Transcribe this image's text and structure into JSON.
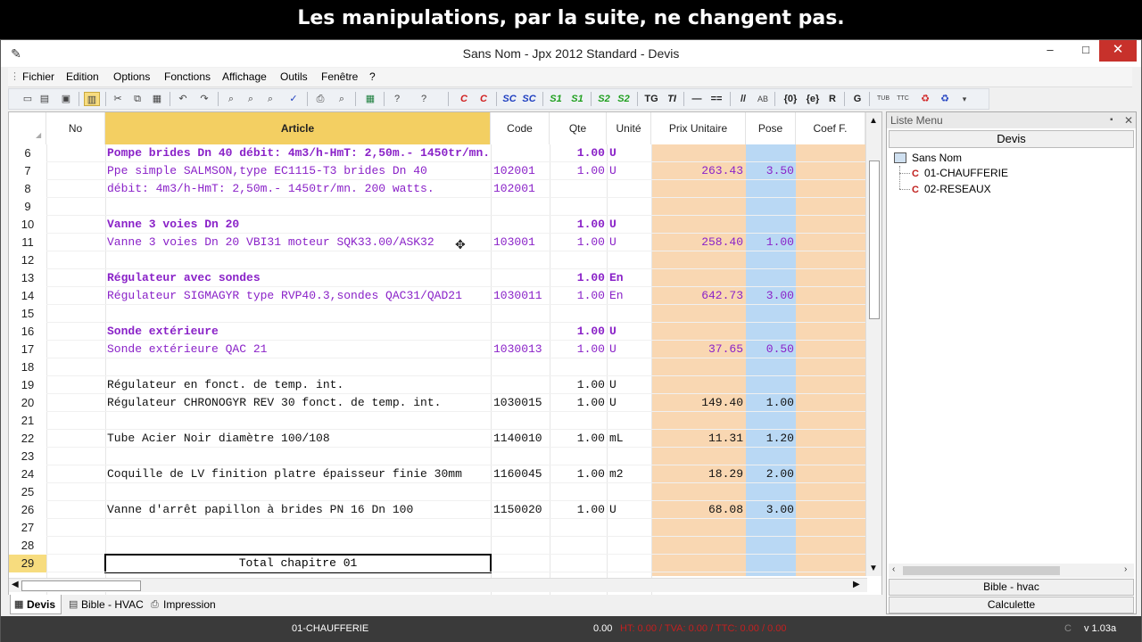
{
  "caption": "Les manipulations, par la suite, ne changent pas.",
  "window": {
    "title": "Sans Nom - Jpx 2012 Standard - Devis",
    "minimize": "–",
    "maximize": "□",
    "close": "✕"
  },
  "menu": [
    "Fichier",
    "Edition",
    "Options",
    "Fonctions",
    "Affichage",
    "Outils",
    "Fenêtre",
    "?"
  ],
  "toolbar": {
    "text_buttons": [
      {
        "label": "C",
        "style": "red",
        "name": "c-red-button"
      },
      {
        "label": "C",
        "style": "red",
        "name": "c-red-italic-button"
      },
      {
        "label": "SC",
        "style": "blue",
        "name": "sc-button"
      },
      {
        "label": "SC",
        "style": "blue",
        "name": "sc-italic-button"
      },
      {
        "label": "S1",
        "style": "green",
        "name": "s1-button"
      },
      {
        "label": "S1",
        "style": "green",
        "name": "s1-italic-button"
      },
      {
        "label": "S2",
        "style": "green",
        "name": "s2-button"
      },
      {
        "label": "S2",
        "style": "green",
        "name": "s2-italic-button"
      },
      {
        "label": "TG",
        "style": "dark",
        "name": "tg-button"
      },
      {
        "label": "TI",
        "style": "dark",
        "name": "ti-button"
      },
      {
        "label": "—",
        "style": "dark",
        "name": "dash-button"
      },
      {
        "label": "==",
        "style": "dark",
        "name": "double-line-button"
      },
      {
        "label": "//",
        "style": "dark",
        "name": "comment-button"
      },
      {
        "label": "AB",
        "style": "gray",
        "name": "ab-button"
      },
      {
        "label": "{0}",
        "style": "dark",
        "name": "brace-zero-button"
      },
      {
        "label": "{e}",
        "style": "dark",
        "name": "brace-e-button"
      },
      {
        "label": "R",
        "style": "dark",
        "name": "r-button"
      },
      {
        "label": "G",
        "style": "dark",
        "name": "g-button"
      },
      {
        "label": "TUB",
        "style": "gray",
        "name": "tub-button"
      },
      {
        "label": "TTC",
        "style": "gray",
        "name": "ttc-button"
      }
    ]
  },
  "grid": {
    "headers": {
      "no": "No",
      "article": "Article",
      "code": "Code",
      "qte": "Qte",
      "unite": "Unité",
      "prix": "Prix Unitaire",
      "pose": "Pose",
      "coef": "Coef F."
    },
    "rows": [
      {
        "n": "6",
        "article": "Pompe brides Dn 40 débit: 4m3/h-HmT: 2,50m.- 1450tr/mn.",
        "code": "",
        "qte": "1.00",
        "unite": "U",
        "prix": "",
        "pose": "",
        "style": "purple-bold"
      },
      {
        "n": "7",
        "article": "Ppe simple SALMSON,type EC1115-T3 brides Dn 40",
        "code": "102001",
        "qte": "1.00",
        "unite": "U",
        "prix": "263.43",
        "pose": "3.50",
        "style": "purple"
      },
      {
        "n": "8",
        "article": "débit: 4m3/h-HmT: 2,50m.- 1450tr/mn. 200 watts.",
        "code": "102001",
        "qte": "",
        "unite": "",
        "prix": "",
        "pose": "",
        "style": "purple"
      },
      {
        "n": "9",
        "article": "",
        "code": "",
        "qte": "",
        "unite": "",
        "prix": "",
        "pose": "",
        "style": "black"
      },
      {
        "n": "10",
        "article": "Vanne 3 voies Dn 20",
        "code": "",
        "qte": "1.00",
        "unite": "U",
        "prix": "",
        "pose": "",
        "style": "purple-bold"
      },
      {
        "n": "11",
        "article": "Vanne 3 voies Dn 20 VBI31 moteur SQK33.00/ASK32",
        "code": "103001",
        "qte": "1.00",
        "unite": "U",
        "prix": "258.40",
        "pose": "1.00",
        "style": "purple"
      },
      {
        "n": "12",
        "article": "",
        "code": "",
        "qte": "",
        "unite": "",
        "prix": "",
        "pose": "",
        "style": "black"
      },
      {
        "n": "13",
        "article": "Régulateur avec sondes",
        "code": "",
        "qte": "1.00",
        "unite": "En",
        "prix": "",
        "pose": "",
        "style": "purple-bold"
      },
      {
        "n": "14",
        "article": "Régulateur SIGMAGYR type RVP40.3,sondes QAC31/QAD21",
        "code": "1030011",
        "qte": "1.00",
        "unite": "En",
        "prix": "642.73",
        "pose": "3.00",
        "style": "purple"
      },
      {
        "n": "15",
        "article": "",
        "code": "",
        "qte": "",
        "unite": "",
        "prix": "",
        "pose": "",
        "style": "black"
      },
      {
        "n": "16",
        "article": "Sonde extérieure",
        "code": "",
        "qte": "1.00",
        "unite": "U",
        "prix": "",
        "pose": "",
        "style": "purple-bold"
      },
      {
        "n": "17",
        "article": "Sonde extérieure QAC 21",
        "code": "1030013",
        "qte": "1.00",
        "unite": "U",
        "prix": "37.65",
        "pose": "0.50",
        "style": "purple"
      },
      {
        "n": "18",
        "article": "",
        "code": "",
        "qte": "",
        "unite": "",
        "prix": "",
        "pose": "",
        "style": "black"
      },
      {
        "n": "19",
        "article": "Régulateur en fonct. de temp. int.",
        "code": "",
        "qte": "1.00",
        "unite": "U",
        "prix": "",
        "pose": "",
        "style": "black"
      },
      {
        "n": "20",
        "article": "Régulateur CHRONOGYR REV 30 fonct. de temp. int.",
        "code": "1030015",
        "qte": "1.00",
        "unite": "U",
        "prix": "149.40",
        "pose": "1.00",
        "style": "black"
      },
      {
        "n": "21",
        "article": "",
        "code": "",
        "qte": "",
        "unite": "",
        "prix": "",
        "pose": "",
        "style": "black"
      },
      {
        "n": "22",
        "article": "Tube Acier Noir diamètre 100/108",
        "code": "1140010",
        "qte": "1.00",
        "unite": "mL",
        "prix": "11.31",
        "pose": "1.20",
        "style": "black"
      },
      {
        "n": "23",
        "article": "",
        "code": "",
        "qte": "",
        "unite": "",
        "prix": "",
        "pose": "",
        "style": "black"
      },
      {
        "n": "24",
        "article": "Coquille de LV finition platre épaisseur finie 30mm",
        "code": "1160045",
        "qte": "1.00",
        "unite": "m2",
        "prix": "18.29",
        "pose": "2.00",
        "style": "black"
      },
      {
        "n": "25",
        "article": "",
        "code": "",
        "qte": "",
        "unite": "",
        "prix": "",
        "pose": "",
        "style": "black"
      },
      {
        "n": "26",
        "article": "Vanne d'arrêt papillon à brides PN 16 Dn 100",
        "code": "1150020",
        "qte": "1.00",
        "unite": "U",
        "prix": "68.08",
        "pose": "3.00",
        "style": "black"
      },
      {
        "n": "27",
        "article": "",
        "code": "",
        "qte": "",
        "unite": "",
        "prix": "",
        "pose": "",
        "style": "black"
      },
      {
        "n": "28",
        "article": "",
        "code": "",
        "qte": "",
        "unite": "",
        "prix": "",
        "pose": "",
        "style": "black"
      },
      {
        "n": "29",
        "article": "Total chapitre 01",
        "code": "",
        "qte": "",
        "unite": "",
        "prix": "",
        "pose": "",
        "style": "total"
      }
    ]
  },
  "side_panel": {
    "title": "Liste Menu",
    "header": "Devis",
    "root": "Sans Nom",
    "items": [
      {
        "marker": "C",
        "label": "01-CHAUFFERIE"
      },
      {
        "marker": "C",
        "label": "02-RESEAUX"
      }
    ],
    "bible_button": "Bible - hvac",
    "calc_button": "Calculette"
  },
  "tabs": [
    {
      "label": "Devis",
      "active": true
    },
    {
      "label": "Bible - HVAC",
      "active": false
    },
    {
      "label": "Impression",
      "active": false
    }
  ],
  "status": {
    "chapter": "01-CHAUFFERIE",
    "amount": "0.00",
    "red_text": "HT: 0.00 / TVA: 0.00 / TTC: 0.00 / 0.00",
    "c_label": "C",
    "version": "v 1.03a"
  },
  "colors": {
    "article_header": "#f3cf62",
    "prix_column": "#f9d7b2",
    "pose_column": "#b9d8f4",
    "chapter_text": "#8a22c8",
    "close_button": "#c7312b"
  }
}
